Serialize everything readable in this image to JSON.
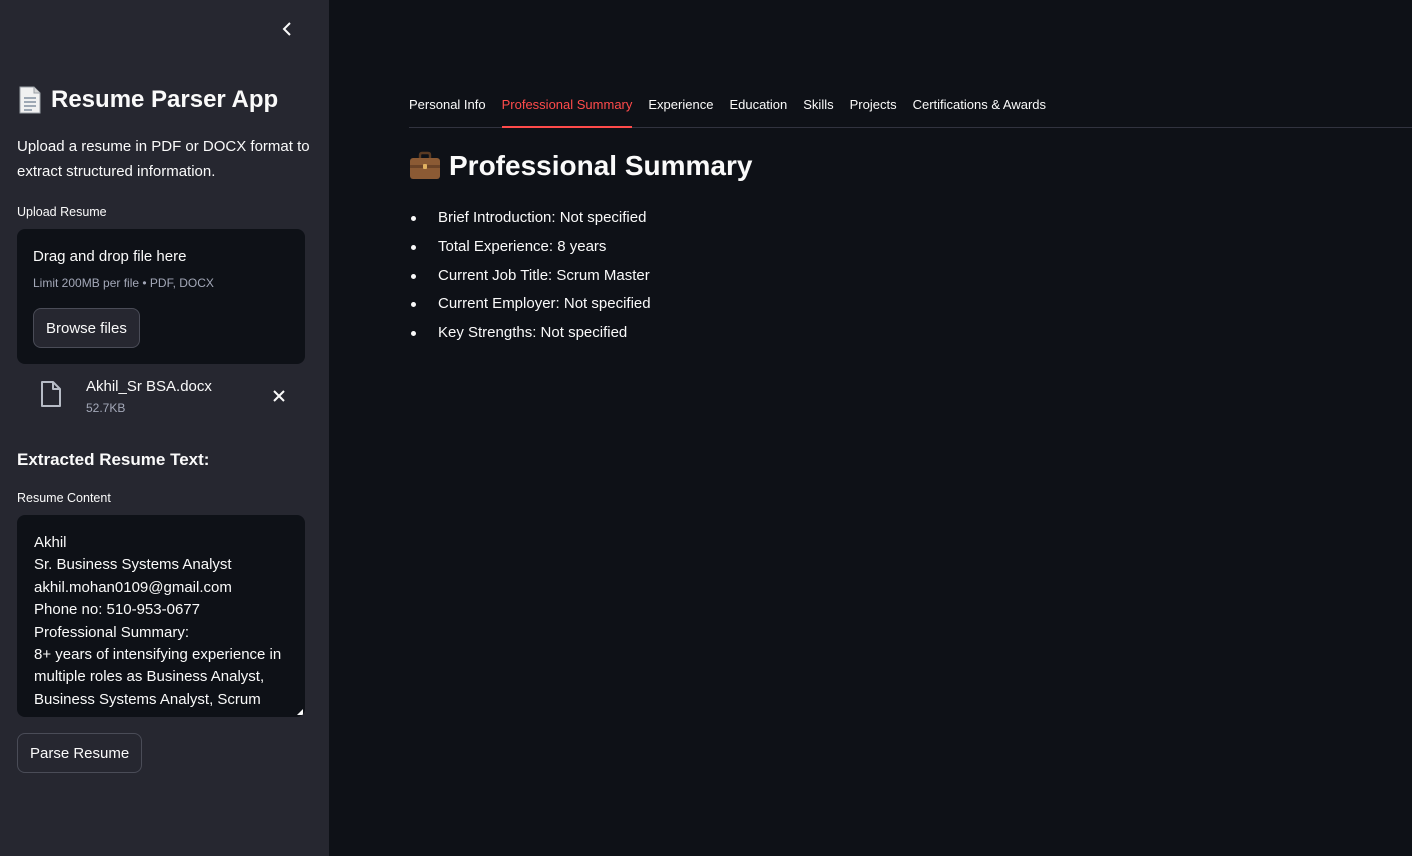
{
  "sidebar": {
    "app_title": "Resume Parser App",
    "description": "Upload a resume in PDF or DOCX format to extract structured information.",
    "upload_label": "Upload Resume",
    "dropzone": {
      "title": "Drag and drop file here",
      "limit": "Limit 200MB per file • PDF, DOCX",
      "browse_label": "Browse files"
    },
    "file": {
      "name": "Akhil_Sr BSA.docx",
      "size": "52.7KB"
    },
    "extracted_heading": "Extracted Resume Text:",
    "content_label": "Resume Content",
    "content_text": "Akhil\nSr. Business Systems Analyst\nakhil.mohan0109@gmail.com\nPhone no: 510-953-0677\nProfessional Summary:\n8+ years of intensifying experience in multiple roles as Business Analyst, Business Systems Analyst, Scrum",
    "parse_label": "Parse Resume"
  },
  "main": {
    "tabs": [
      {
        "label": "Personal Info"
      },
      {
        "label": "Professional Summary",
        "active": true
      },
      {
        "label": "Experience"
      },
      {
        "label": "Education"
      },
      {
        "label": "Skills"
      },
      {
        "label": "Projects"
      },
      {
        "label": "Certifications & Awards"
      }
    ],
    "section_title": "Professional Summary",
    "summary_items": [
      "Brief Introduction: Not specified",
      "Total Experience: 8 years",
      "Current Job Title: Scrum Master",
      "Current Employer: Not specified",
      "Key Strengths: Not specified"
    ]
  },
  "colors": {
    "background": "#0e1117",
    "sidebar": "#262730",
    "accent": "#ff4b4b",
    "text": "#fafafa"
  },
  "icons": {
    "title_icon": "page-document-icon",
    "section_icon": "briefcase-icon",
    "file_icon": "file-outline-icon",
    "close_icon": "close-icon",
    "collapse_icon": "chevron-left-icon"
  }
}
